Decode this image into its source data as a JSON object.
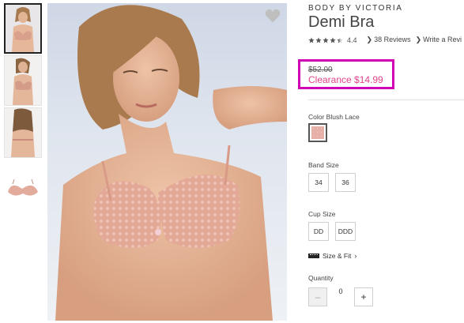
{
  "thumbnails": [
    {
      "label": "front",
      "selected": true
    },
    {
      "label": "side",
      "selected": false
    },
    {
      "label": "back",
      "selected": false
    },
    {
      "label": "product",
      "selected": false
    }
  ],
  "main_image": {
    "favorite_icon": "heart-icon"
  },
  "product": {
    "brand": "BODY BY VICTORIA",
    "name": "Demi Bra",
    "rating": {
      "value": "4.4",
      "stars": 4.4,
      "reviews": "38 Reviews",
      "write": "Write a Revi"
    },
    "price": {
      "original": "$52.00",
      "sale": "Clearance $14.99"
    },
    "color": {
      "label": "Color Blush Lace",
      "swatch_color": "#e7b0a6"
    },
    "band_size": {
      "label": "Band Size",
      "options": [
        "34",
        "36"
      ]
    },
    "cup_size": {
      "label": "Cup Size",
      "options": [
        "DD",
        "DDD"
      ]
    },
    "size_fit": "Size & Fit",
    "quantity": {
      "label": "Quantity",
      "value": "0",
      "minus": "–",
      "plus": "+"
    }
  },
  "colors": {
    "accent_box": "#d000b4",
    "sale_text": "#e0428a"
  }
}
